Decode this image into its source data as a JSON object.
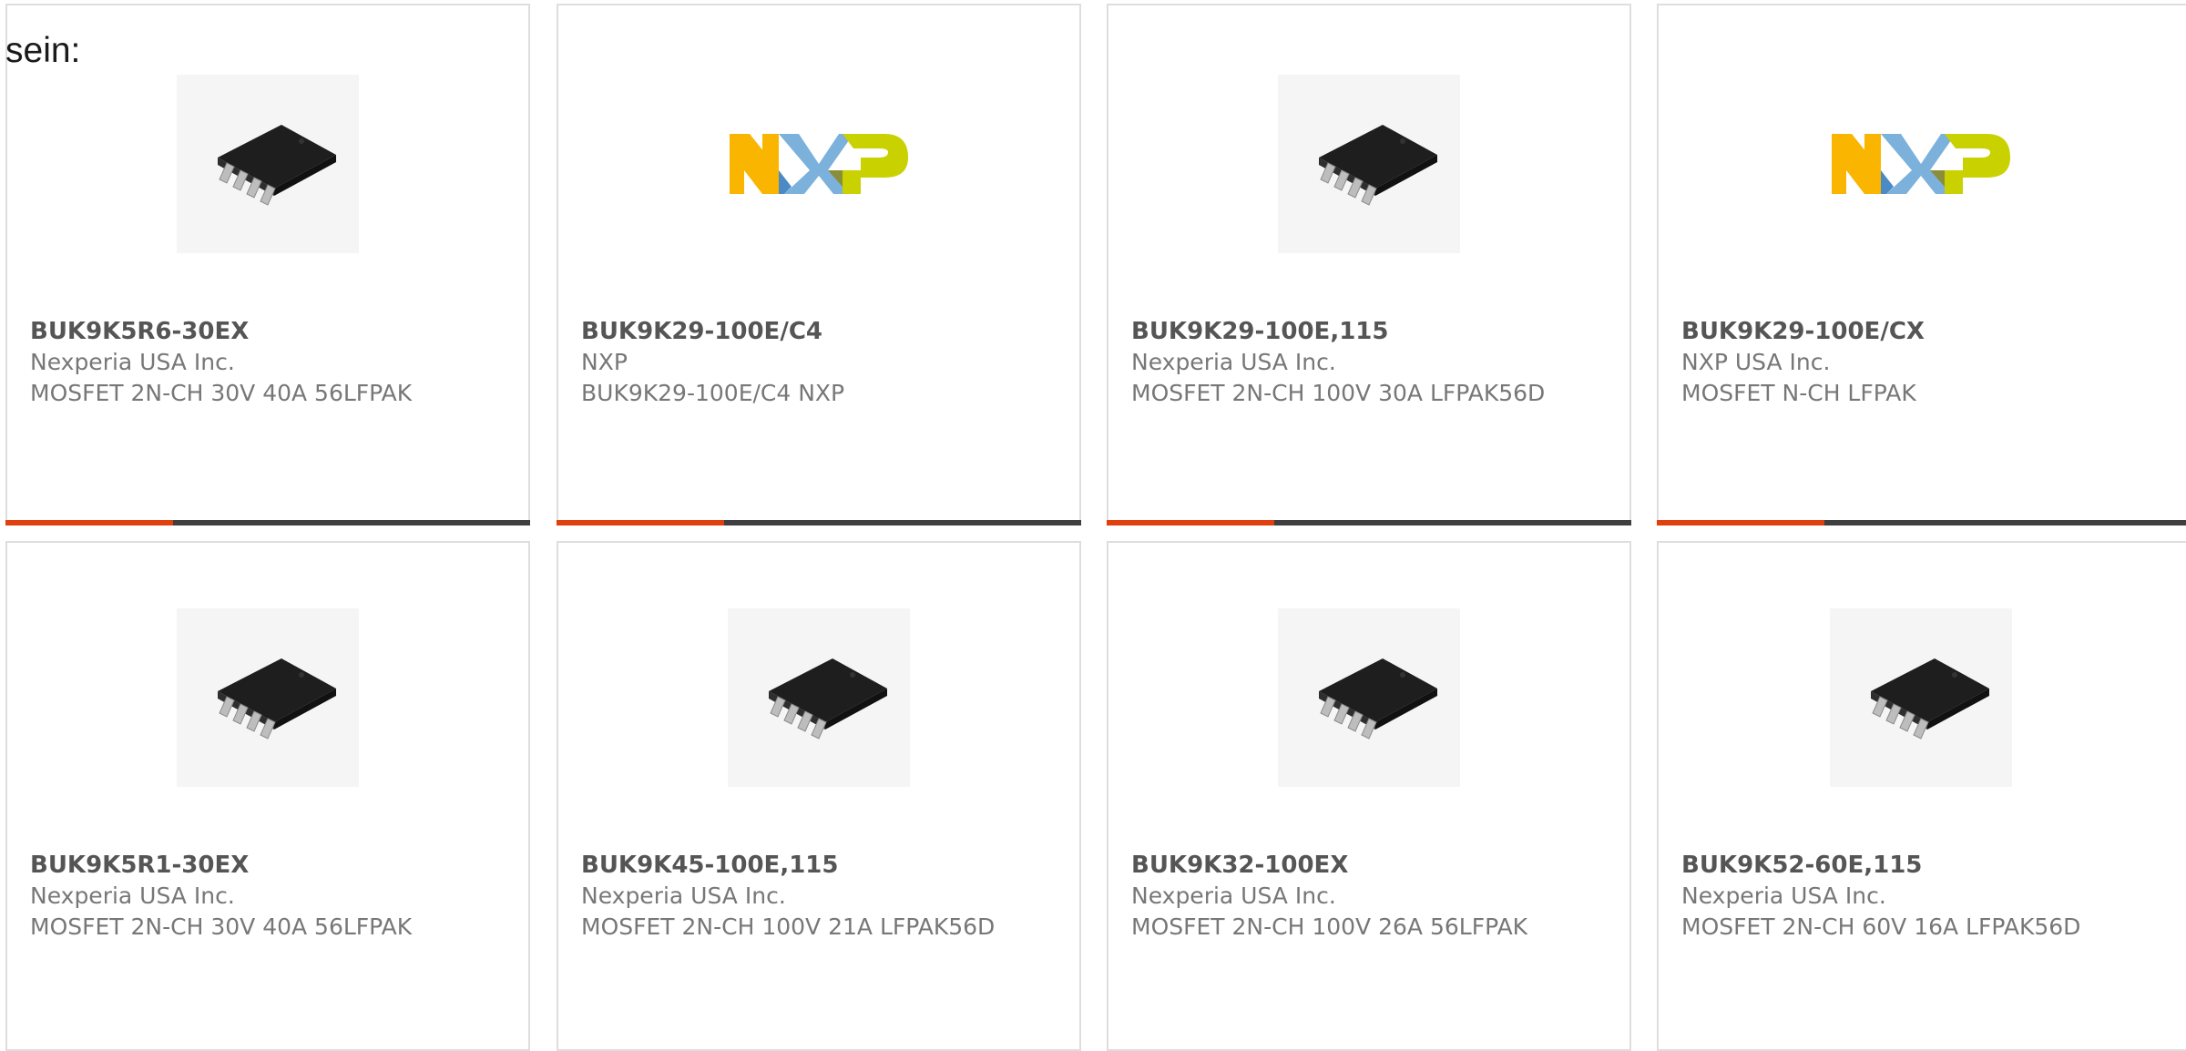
{
  "intro_text": "sein:",
  "products": [
    {
      "part_number": "BUK9K5R6-30EX",
      "manufacturer": "Nexperia USA Inc.",
      "description": "MOSFET 2N-CH 30V 40A 56LFPAK",
      "image": "chip-image"
    },
    {
      "part_number": "BUK9K29-100E/C4",
      "manufacturer": "NXP",
      "description": "BUK9K29-100E/C4 NXP",
      "image": "nxp-logo"
    },
    {
      "part_number": "BUK9K29-100E,115",
      "manufacturer": "Nexperia USA Inc.",
      "description": "MOSFET 2N-CH 100V 30A LFPAK56D",
      "image": "chip-image"
    },
    {
      "part_number": "BUK9K29-100E/CX",
      "manufacturer": "NXP USA Inc.",
      "description": "MOSFET N-CH LFPAK",
      "image": "nxp-logo"
    },
    {
      "part_number": "BUK9K5R1-30EX",
      "manufacturer": "Nexperia USA Inc.",
      "description": "MOSFET 2N-CH 30V 40A 56LFPAK",
      "image": "chip-image"
    },
    {
      "part_number": "BUK9K45-100E,115",
      "manufacturer": "Nexperia USA Inc.",
      "description": "MOSFET 2N-CH 100V 21A LFPAK56D",
      "image": "chip-image"
    },
    {
      "part_number": "BUK9K32-100EX",
      "manufacturer": "Nexperia USA Inc.",
      "description": "MOSFET 2N-CH 100V 26A 56LFPAK",
      "image": "chip-image"
    },
    {
      "part_number": "BUK9K52-60E,115",
      "manufacturer": "Nexperia USA Inc.",
      "description": "MOSFET 2N-CH 60V 16A LFPAK56D",
      "image": "chip-image"
    }
  ],
  "logo_text": "NXP",
  "colors": {
    "accent": "#e0400d",
    "bar": "#3f3f3f",
    "border": "#dedede",
    "nxp_orange": "#f9b500",
    "nxp_blue": "#7bb1db",
    "nxp_green": "#c9d200"
  }
}
